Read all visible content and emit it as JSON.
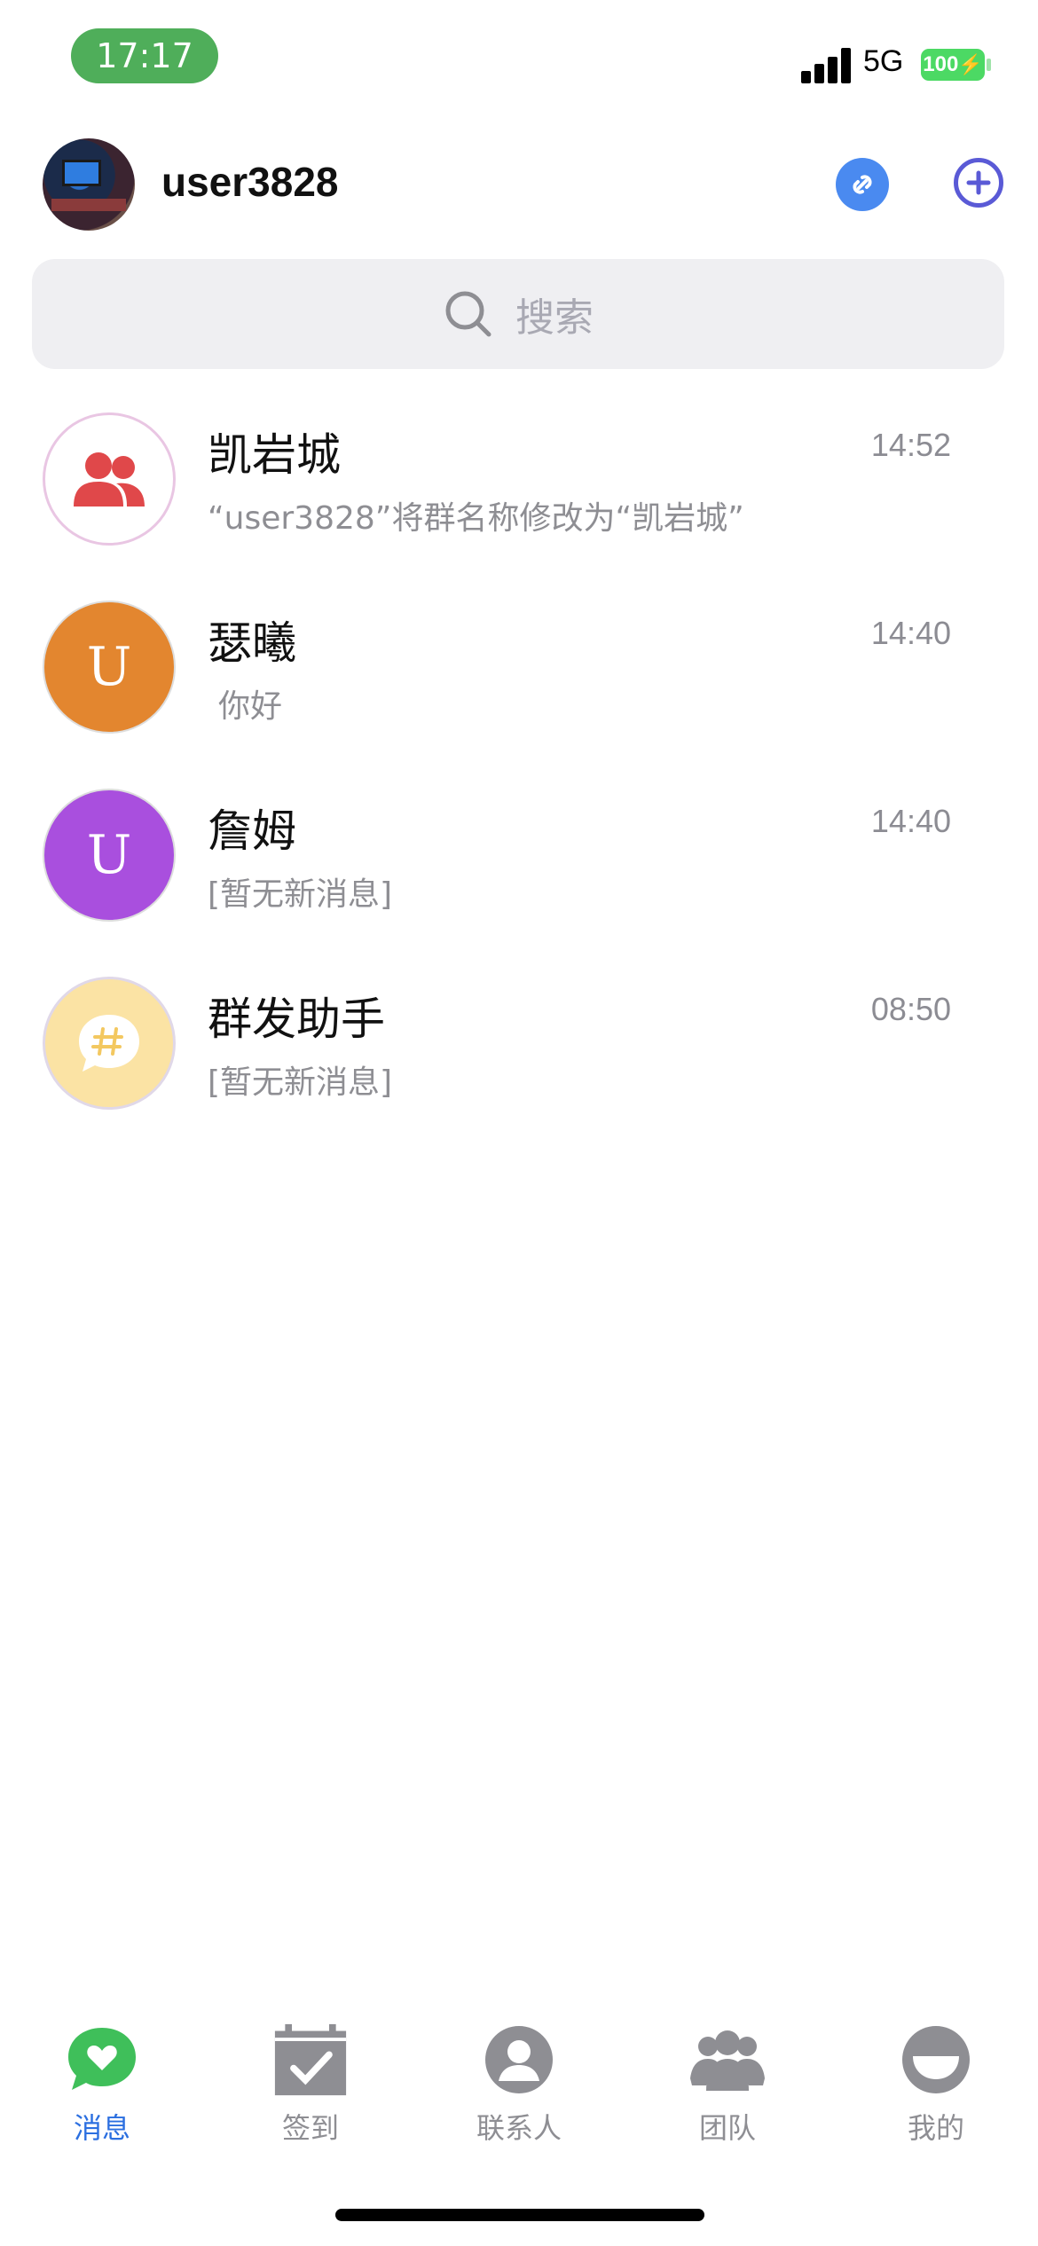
{
  "status_bar": {
    "time": "17:17",
    "network": "5G",
    "battery": "100"
  },
  "header": {
    "username": "user3828"
  },
  "search": {
    "placeholder": "搜索"
  },
  "conversations": [
    {
      "name": "凯岩城",
      "time": "14:52",
      "preview": "“user3828”将群名称修改为“凯岩城”",
      "avatar_type": "group-icon"
    },
    {
      "name": "瑟曦",
      "time": "14:40",
      "preview": "你好",
      "avatar_letter": "U",
      "avatar_color": "#e3862f"
    },
    {
      "name": "詹姆",
      "time": "14:40",
      "preview": "[暂无新消息]",
      "avatar_letter": "U",
      "avatar_color": "#a94fde"
    },
    {
      "name": "群发助手",
      "time": "08:50",
      "preview": "[暂无新消息]",
      "avatar_type": "broadcast-icon"
    }
  ],
  "tabs": [
    {
      "label": "消息",
      "icon": "message-heart-icon",
      "active": true
    },
    {
      "label": "签到",
      "icon": "calendar-check-icon",
      "active": false
    },
    {
      "label": "联系人",
      "icon": "contact-icon",
      "active": false
    },
    {
      "label": "团队",
      "icon": "team-icon",
      "active": false
    },
    {
      "label": "我的",
      "icon": "profile-face-icon",
      "active": false
    }
  ],
  "colors": {
    "accent": "#2b6fe0",
    "time_pill": "#4fae5a",
    "battery": "#4cd964",
    "group_icon": "#e0484a"
  }
}
